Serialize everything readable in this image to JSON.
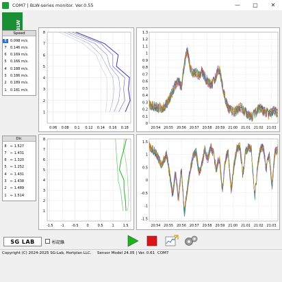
{
  "window": {
    "title": "COM7 | BLW-series monitor. Ver.0.55",
    "minimize_glyph": "—",
    "maximize_glyph": "□",
    "close_glyph": "✕"
  },
  "logo": {
    "text": "BLW"
  },
  "speed_panel": {
    "header": "Speed",
    "rows": [
      {
        "idx": "8",
        "value": "0.098 m/s."
      },
      {
        "idx": "7",
        "value": "0.146 m/s."
      },
      {
        "idx": "6",
        "value": "0.169 m/s."
      },
      {
        "idx": "5",
        "value": "0.166 m/s."
      },
      {
        "idx": "4",
        "value": "0.188 m/s."
      },
      {
        "idx": "3",
        "value": "0.186 m/s."
      },
      {
        "idx": "2",
        "value": "0.189 m/s."
      },
      {
        "idx": "1",
        "value": "0.181 m/s."
      }
    ]
  },
  "dir_panel": {
    "header": "Dir.",
    "rows": [
      {
        "idx": "8",
        "value": "← 1.527"
      },
      {
        "idx": "7",
        "value": "← 1.431"
      },
      {
        "idx": "6",
        "value": "← 1.320"
      },
      {
        "idx": "5",
        "value": "← 1.252"
      },
      {
        "idx": "4",
        "value": "← 1.431"
      },
      {
        "idx": "3",
        "value": "← 1.438"
      },
      {
        "idx": "2",
        "value": "← 1.489"
      },
      {
        "idx": "1",
        "value": "← 1.514"
      }
    ]
  },
  "colors": {
    "speed_profile": "#3a3ab0",
    "dir_profile": "#22b022",
    "selection": "#2a6fd6",
    "logo_green": "#1a8f35",
    "play_green": "#20b020",
    "stop_red": "#d81818"
  },
  "chart_data": [
    {
      "type": "line",
      "ylim": [
        0,
        8
      ],
      "xlim": [
        0.05,
        0.19
      ],
      "xticks": [
        "0.06",
        "0.08",
        "0.1",
        "0.12",
        "0.14",
        "0.16",
        "0.18"
      ],
      "yticks": [
        "1",
        "2",
        "3",
        "4",
        "5",
        "6",
        "7",
        "8"
      ],
      "y": [
        8,
        7,
        6,
        5,
        4,
        3,
        2,
        1
      ],
      "series": [
        {
          "values": [
            0.098,
            0.146,
            0.169,
            0.166,
            0.188,
            0.186,
            0.189,
            0.181
          ]
        },
        {
          "values": [
            0.092,
            0.14,
            0.16,
            0.16,
            0.18,
            0.178,
            0.18,
            0.17
          ]
        },
        {
          "values": [
            0.085,
            0.13,
            0.15,
            0.155,
            0.17,
            0.172,
            0.17,
            0.162
          ]
        },
        {
          "values": [
            0.078,
            0.12,
            0.14,
            0.15,
            0.16,
            0.162,
            0.16,
            0.155
          ]
        },
        {
          "values": [
            0.07,
            0.11,
            0.132,
            0.14,
            0.15,
            0.15,
            0.15,
            0.148
          ]
        }
      ]
    },
    {
      "type": "line",
      "ylim": [
        0,
        8
      ],
      "xlim": [
        -1.6,
        1.7
      ],
      "xticks": [
        "-1.5",
        "-1",
        "-0.5",
        "0",
        "0.5",
        "1",
        "1.5"
      ],
      "yticks": [
        "1",
        "2",
        "3",
        "4",
        "5",
        "6",
        "7",
        "8"
      ],
      "y": [
        8,
        7,
        6,
        5,
        4,
        3,
        2,
        1
      ],
      "series": [
        {
          "values": [
            1.527,
            1.431,
            1.32,
            1.252,
            1.431,
            1.438,
            1.489,
            1.514
          ]
        },
        {
          "values": [
            1.1,
            1.12,
            1.15,
            1.18,
            1.2,
            1.3,
            1.35,
            1.4
          ]
        },
        {
          "values": [
            1.45,
            1.4,
            1.5,
            1.55,
            1.58,
            1.6,
            1.62,
            1.58
          ]
        }
      ]
    },
    {
      "type": "line",
      "ylim": [
        0,
        1.3
      ],
      "yticks": [
        "0",
        "0.1",
        "0.2",
        "0.3",
        "0.4",
        "0.5",
        "0.6",
        "0.7",
        "0.8",
        "0.9",
        "1",
        "1.1",
        "1.2",
        "1.3"
      ],
      "xticks": [
        "20:54",
        "20:55",
        "20:56",
        "20:57",
        "20:58",
        "20:59",
        "21:00",
        "21:01",
        "21:02",
        "21:03"
      ],
      "series_colors": [
        "#1f3fbf",
        "#d02020",
        "#2a9a2a",
        "#e07020",
        "#8a2aa0",
        "#2090b0",
        "#707070",
        "#c0a020"
      ],
      "base_profile": [
        0.26,
        0.25,
        0.24,
        0.22,
        0.22,
        0.23,
        0.28,
        0.35,
        0.45,
        0.55,
        0.6,
        0.52,
        0.85,
        1.05,
        0.8,
        0.7,
        0.72,
        0.68,
        0.75,
        0.65,
        0.6,
        0.55,
        0.58,
        0.7,
        0.78,
        0.55,
        0.35,
        0.22,
        0.18,
        0.16,
        0.18,
        0.22,
        0.2,
        0.15,
        0.12,
        0.1,
        0.12,
        0.2,
        0.22,
        0.18,
        0.15,
        0.12,
        0.15,
        0.18,
        0.14
      ]
    },
    {
      "type": "line",
      "ylim": [
        -1.6,
        1.6
      ],
      "yticks": [
        "-1.5",
        "-1",
        "-0.5",
        "0",
        "0.5",
        "1",
        "1.5"
      ],
      "xticks": [
        "20:54",
        "20:55",
        "20:56",
        "20:57",
        "20:58",
        "20:59",
        "21:00",
        "21:01",
        "21:02",
        "21:03"
      ],
      "series_colors": [
        "#1f3fbf",
        "#d02020",
        "#2a9a2a",
        "#e07020",
        "#8a2aa0",
        "#2090b0",
        "#707070",
        "#c0a020"
      ],
      "base_profile": [
        1.3,
        1.2,
        1.1,
        0.9,
        0.6,
        0.8,
        1.0,
        0.2,
        -0.6,
        0.3,
        -0.8,
        0.5,
        -1.3,
        -0.4,
        0.4,
        0.9,
        1.1,
        0.3,
        0.6,
        1.2,
        0.8,
        1.3,
        1.0,
        0.4,
        0.9,
        -0.4,
        0.8,
        1.1,
        -0.5,
        0.6,
        1.2,
        1.3,
        0.2,
        1.1,
        1.3,
        1.2,
        -0.8,
        0.5,
        1.2,
        1.3,
        0.4,
        1.0,
        -0.3,
        1.1,
        1.2
      ]
    }
  ],
  "controls": {
    "sglab_text": "SG LAB",
    "checkbox_label": "杉記錄"
  },
  "status": {
    "copyright": "Copyright (C) 2024-2025 SG-Lab, Hortplan LLC.",
    "sensor_model": "Sensor Model 24.05 | Ver. 0.61",
    "port": "COM7"
  }
}
